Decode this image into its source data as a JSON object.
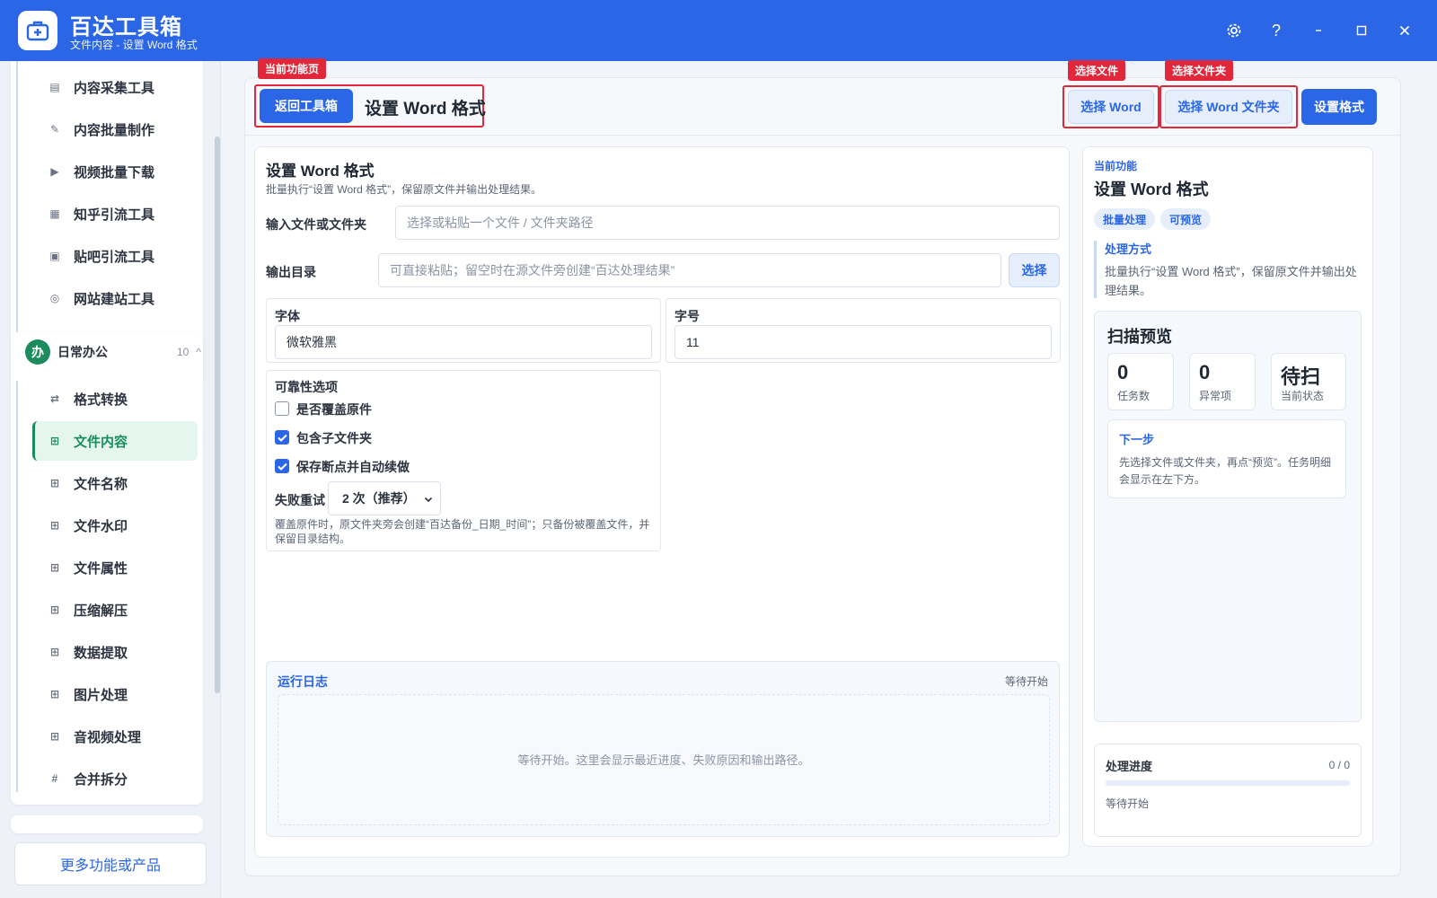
{
  "window": {
    "title": "百达工具箱",
    "subtitle": "文件内容 - 设置 Word 格式",
    "controls": [
      "settings-icon",
      "help-icon",
      "minimize-icon",
      "maximize-icon",
      "close-icon"
    ],
    "help_glyph": "?",
    "accent": "#2b66e6"
  },
  "sidebar": {
    "top_items": [
      {
        "label": "内容采集工具",
        "icon": "document-icon"
      },
      {
        "label": "内容批量制作",
        "icon": "pen-icon"
      },
      {
        "label": "视频批量下载",
        "icon": "video-icon"
      },
      {
        "label": "知乎引流工具",
        "icon": "zhihu-icon"
      },
      {
        "label": "贴吧引流工具",
        "icon": "tieba-icon"
      },
      {
        "label": "网站建站工具",
        "icon": "globe-icon"
      }
    ],
    "group": {
      "badge": "办",
      "label": "日常办公",
      "count": "10",
      "toggle": "^"
    },
    "group_items": [
      {
        "label": "格式转换",
        "icon": "swap-icon"
      },
      {
        "label": "文件内容",
        "icon": "grid-icon",
        "active": true
      },
      {
        "label": "文件名称",
        "icon": "grid-icon"
      },
      {
        "label": "文件水印",
        "icon": "grid-icon"
      },
      {
        "label": "文件属性",
        "icon": "grid-icon"
      },
      {
        "label": "压缩解压",
        "icon": "grid-icon"
      },
      {
        "label": "数据提取",
        "icon": "grid-icon"
      },
      {
        "label": "图片处理",
        "icon": "grid-icon"
      },
      {
        "label": "音视频处理",
        "icon": "grid-icon"
      },
      {
        "label": "合并拆分",
        "icon": "hash-icon"
      }
    ],
    "more_label": "更多功能或产品",
    "active_color": "#1c8c5e"
  },
  "toolbar": {
    "back_label": "返回工具箱",
    "page_title": "设置 Word 格式",
    "select_word_label": "选择 Word",
    "select_folder_label": "选择 Word 文件夹",
    "set_format_label": "设置格式",
    "callouts": {
      "current": "当前功能页",
      "select_file": "选择文件",
      "select_folder": "选择文件夹"
    },
    "callout_color": "#e0283a"
  },
  "form": {
    "title": "设置 Word 格式",
    "description": "批量执行“设置 Word 格式”，保留原文件并输出处理结果。",
    "input_label": "输入文件或文件夹",
    "input_placeholder": "选择或粘贴一个文件 / 文件夹路径",
    "output_label": "输出目录",
    "output_placeholder": "可直接粘贴；留空时在源文件旁创建“百达处理结果”",
    "output_button": "选择",
    "font_label": "字体",
    "font_value": "微软雅黑",
    "size_label": "字号",
    "size_value": "11",
    "reliability": {
      "title": "可靠性选项",
      "options": [
        {
          "label": "是否覆盖原件",
          "checked": false
        },
        {
          "label": "包含子文件夹",
          "checked": true
        },
        {
          "label": "保存断点并自动续做",
          "checked": true
        }
      ],
      "retry_label": "失败重试",
      "retry_value": "2 次（推荐）",
      "note": "覆盖原件时，原文件夹旁会创建“百达备份_日期_时间”；只备份被覆盖文件，并保留目录结构。"
    }
  },
  "log": {
    "title": "运行日志",
    "status": "等待开始",
    "placeholder": "等待开始。这里会显示最近进度、失败原因和输出路径。"
  },
  "info": {
    "kicker": "当前功能",
    "title": "设置 Word 格式",
    "tags": [
      "批量处理",
      "可预览"
    ],
    "method_title": "处理方式",
    "method_text": "批量执行“设置 Word 格式”，保留原文件并输出处理结果。",
    "scan": {
      "title": "扫描预览",
      "stats": [
        {
          "value": "0",
          "label": "任务数"
        },
        {
          "value": "0",
          "label": "异常项"
        },
        {
          "value": "待扫",
          "label": "当前状态"
        }
      ],
      "next_title": "下一步",
      "next_text": "先选择文件或文件夹，再点“预览”。任务明细会显示在左下方。"
    },
    "progress": {
      "title": "处理进度",
      "count": "0 / 0",
      "fraction": 0,
      "status": "等待开始"
    }
  }
}
